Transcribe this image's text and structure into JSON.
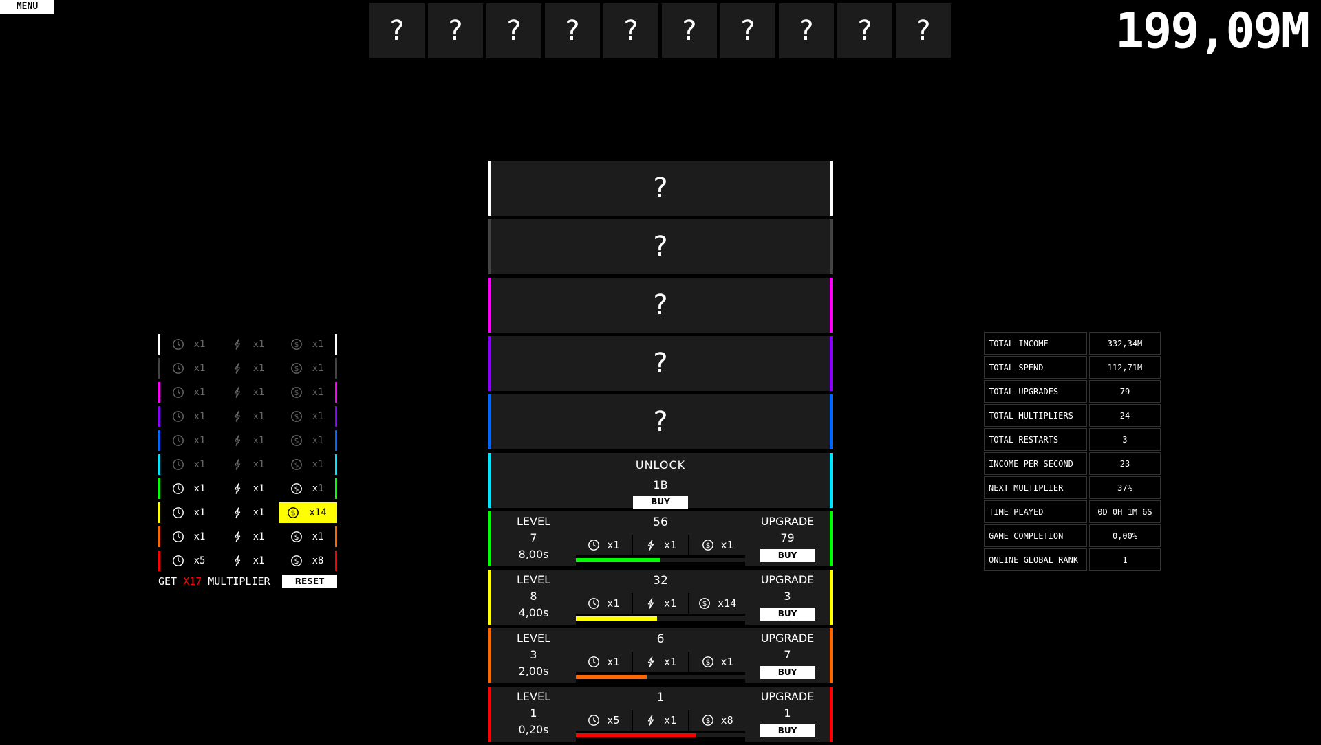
{
  "menu": {
    "label": "MENU"
  },
  "top_slots": [
    "?",
    "?",
    "?",
    "?",
    "?",
    "?",
    "?",
    "?",
    "?",
    "?"
  ],
  "money": "199,09M",
  "locked_rows": [
    {
      "label": "?",
      "color": "#ffffff"
    },
    {
      "label": "?",
      "color": "#444444"
    },
    {
      "label": "?",
      "color": "#ff00ff"
    },
    {
      "label": "?",
      "color": "#8a00ff"
    },
    {
      "label": "?",
      "color": "#0066ff"
    }
  ],
  "unlock_row": {
    "label": "UNLOCK",
    "price": "1B",
    "buy_label": "BUY",
    "color": "#00e5ff"
  },
  "active_rows": [
    {
      "color": "#00ff00",
      "level_label": "LEVEL",
      "level": "7",
      "time": "8,00s",
      "count": "56",
      "mults": [
        "x1",
        "x1",
        "x1"
      ],
      "progress": 0.5,
      "upgrade_label": "UPGRADE",
      "upgrade_cost": "79",
      "buy_label": "BUY"
    },
    {
      "color": "#ffff00",
      "level_label": "LEVEL",
      "level": "8",
      "time": "4,00s",
      "count": "32",
      "mults": [
        "x1",
        "x1",
        "x14"
      ],
      "progress": 0.48,
      "upgrade_label": "UPGRADE",
      "upgrade_cost": "3",
      "buy_label": "BUY"
    },
    {
      "color": "#ff6600",
      "level_label": "LEVEL",
      "level": "3",
      "time": "2,00s",
      "count": "6",
      "mults": [
        "x1",
        "x1",
        "x1"
      ],
      "progress": 0.42,
      "upgrade_label": "UPGRADE",
      "upgrade_cost": "7",
      "buy_label": "BUY"
    },
    {
      "color": "#ff0000",
      "level_label": "LEVEL",
      "level": "1",
      "time": "0,20s",
      "count": "1",
      "mults": [
        "x5",
        "x1",
        "x8"
      ],
      "progress": 0.71,
      "upgrade_label": "UPGRADE",
      "upgrade_cost": "1",
      "buy_label": "BUY"
    }
  ],
  "multiplier_table": [
    {
      "color": "#ffffff",
      "dim": true,
      "values": [
        "x1",
        "x1",
        "x1"
      ],
      "hl": -1
    },
    {
      "color": "#444444",
      "dim": true,
      "values": [
        "x1",
        "x1",
        "x1"
      ],
      "hl": -1
    },
    {
      "color": "#ff00ff",
      "dim": true,
      "values": [
        "x1",
        "x1",
        "x1"
      ],
      "hl": -1
    },
    {
      "color": "#8a00ff",
      "dim": true,
      "values": [
        "x1",
        "x1",
        "x1"
      ],
      "hl": -1
    },
    {
      "color": "#0066ff",
      "dim": true,
      "values": [
        "x1",
        "x1",
        "x1"
      ],
      "hl": -1
    },
    {
      "color": "#00e5ff",
      "dim": true,
      "values": [
        "x1",
        "x1",
        "x1"
      ],
      "hl": -1
    },
    {
      "color": "#00ff00",
      "dim": false,
      "values": [
        "x1",
        "x1",
        "x1"
      ],
      "hl": -1
    },
    {
      "color": "#ffff00",
      "dim": false,
      "values": [
        "x1",
        "x1",
        "x14"
      ],
      "hl": 2
    },
    {
      "color": "#ff6600",
      "dim": false,
      "values": [
        "x1",
        "x1",
        "x1"
      ],
      "hl": -1
    },
    {
      "color": "#ff0000",
      "dim": false,
      "values": [
        "x5",
        "x1",
        "x8"
      ],
      "hl": -1
    }
  ],
  "multiplier_footer": {
    "prefix": "GET",
    "value": "X17",
    "suffix": "MULTIPLIER",
    "reset_label": "RESET"
  },
  "stats": [
    {
      "label": "TOTAL INCOME",
      "value": "332,34M"
    },
    {
      "label": "TOTAL SPEND",
      "value": "112,71M"
    },
    {
      "label": "TOTAL UPGRADES",
      "value": "79"
    },
    {
      "label": "TOTAL MULTIPLIERS",
      "value": "24"
    },
    {
      "label": "TOTAL RESTARTS",
      "value": "3"
    },
    {
      "label": "INCOME PER SECOND",
      "value": "23"
    },
    {
      "label": "NEXT MULTIPLIER",
      "value": "37%"
    },
    {
      "label": "TIME PLAYED",
      "value": "0D 0H 1M 6S"
    },
    {
      "label": "GAME COMPLETION",
      "value": "0,00%"
    },
    {
      "label": "ONLINE GLOBAL RANK",
      "value": "1"
    }
  ],
  "icons": [
    "clock-icon",
    "lightning-icon",
    "dollar-icon"
  ]
}
